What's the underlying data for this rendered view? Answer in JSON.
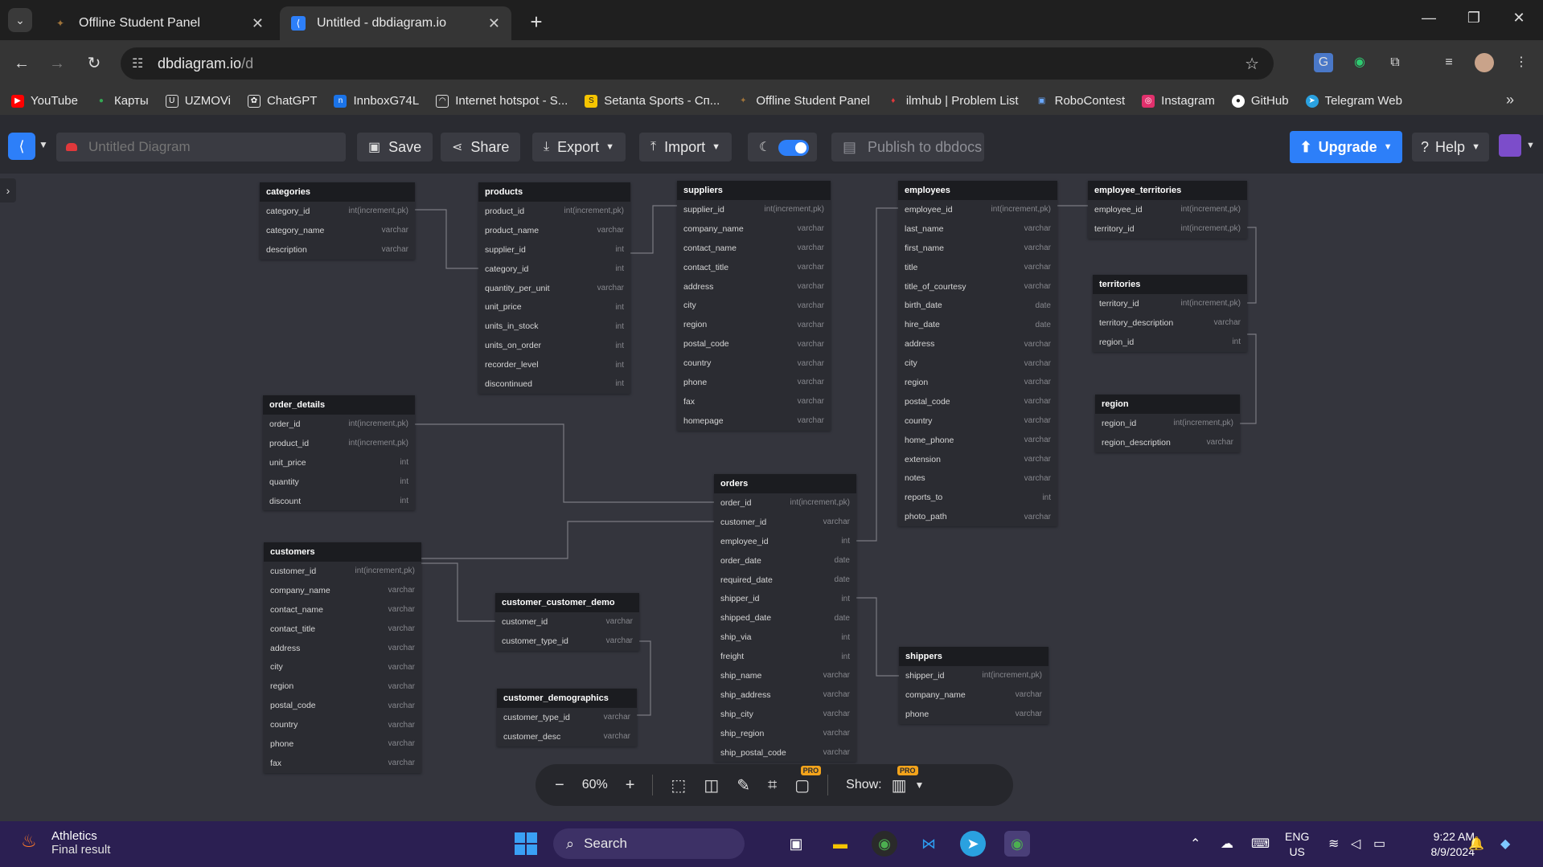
{
  "browser": {
    "tabs": [
      {
        "title": "Offline Student Panel",
        "active": false
      },
      {
        "title": "Untitled - dbdiagram.io",
        "active": true
      }
    ],
    "url_host": "dbdiagram.io",
    "url_path": "/d",
    "bookmarks": [
      {
        "label": "YouTube",
        "icon": "youtube-icon",
        "color": "#ff0000"
      },
      {
        "label": "Карты",
        "icon": "maps-pin-icon",
        "color": "#34a853"
      },
      {
        "label": "UZMOVi",
        "icon": "uzmovi-icon",
        "color": "#ffffff"
      },
      {
        "label": "ChatGPT",
        "icon": "chatgpt-icon",
        "color": "#ffffff"
      },
      {
        "label": "InnboxG74L",
        "icon": "innbox-icon",
        "color": "#1a73e8"
      },
      {
        "label": "Internet hotspot - S...",
        "icon": "hotspot-icon",
        "color": "#ffffff"
      },
      {
        "label": "Setanta Sports - Сп...",
        "icon": "setanta-icon",
        "color": "#f5c400"
      },
      {
        "label": "Offline Student Panel",
        "icon": "student-panel-icon",
        "color": "#a0743a"
      },
      {
        "label": "ilmhub | Problem List",
        "icon": "ilmhub-icon",
        "color": "#e0383b"
      },
      {
        "label": "RoboContest",
        "icon": "robocontest-icon",
        "color": "#6aa9ff"
      },
      {
        "label": "Instagram",
        "icon": "instagram-icon",
        "color": "#e1306c"
      },
      {
        "label": "GitHub",
        "icon": "github-icon",
        "color": "#ffffff"
      },
      {
        "label": "Telegram Web",
        "icon": "telegram-icon",
        "color": "#2aa1e0"
      }
    ]
  },
  "toolbar": {
    "diagram_title_placeholder": "Untitled Diagram",
    "save_label": "Save",
    "share_label": "Share",
    "export_label": "Export",
    "import_label": "Import",
    "publish_label": "Publish to dbdocs",
    "upgrade_label": "Upgrade",
    "help_label": "Help"
  },
  "tables": [
    {
      "name": "categories",
      "columns": [
        {
          "name": "category_id",
          "type": "int(increment,pk)"
        },
        {
          "name": "category_name",
          "type": "varchar"
        },
        {
          "name": "description",
          "type": "varchar"
        }
      ]
    },
    {
      "name": "products",
      "columns": [
        {
          "name": "product_id",
          "type": "int(increment,pk)"
        },
        {
          "name": "product_name",
          "type": "varchar"
        },
        {
          "name": "supplier_id",
          "type": "int"
        },
        {
          "name": "category_id",
          "type": "int"
        },
        {
          "name": "quantity_per_unit",
          "type": "varchar"
        },
        {
          "name": "unit_price",
          "type": "int"
        },
        {
          "name": "units_in_stock",
          "type": "int"
        },
        {
          "name": "units_on_order",
          "type": "int"
        },
        {
          "name": "recorder_level",
          "type": "int"
        },
        {
          "name": "discontinued",
          "type": "int"
        }
      ]
    },
    {
      "name": "suppliers",
      "columns": [
        {
          "name": "supplier_id",
          "type": "int(increment,pk)"
        },
        {
          "name": "company_name",
          "type": "varchar"
        },
        {
          "name": "contact_name",
          "type": "varchar"
        },
        {
          "name": "contact_title",
          "type": "varchar"
        },
        {
          "name": "address",
          "type": "varchar"
        },
        {
          "name": "city",
          "type": "varchar"
        },
        {
          "name": "region",
          "type": "varchar"
        },
        {
          "name": "postal_code",
          "type": "varchar"
        },
        {
          "name": "country",
          "type": "varchar"
        },
        {
          "name": "phone",
          "type": "varchar"
        },
        {
          "name": "fax",
          "type": "varchar"
        },
        {
          "name": "homepage",
          "type": "varchar"
        }
      ]
    },
    {
      "name": "employees",
      "columns": [
        {
          "name": "employee_id",
          "type": "int(increment,pk)"
        },
        {
          "name": "last_name",
          "type": "varchar"
        },
        {
          "name": "first_name",
          "type": "varchar"
        },
        {
          "name": "title",
          "type": "varchar"
        },
        {
          "name": "title_of_courtesy",
          "type": "varchar"
        },
        {
          "name": "birth_date",
          "type": "date"
        },
        {
          "name": "hire_date",
          "type": "date"
        },
        {
          "name": "address",
          "type": "varchar"
        },
        {
          "name": "city",
          "type": "varchar"
        },
        {
          "name": "region",
          "type": "varchar"
        },
        {
          "name": "postal_code",
          "type": "varchar"
        },
        {
          "name": "country",
          "type": "varchar"
        },
        {
          "name": "home_phone",
          "type": "varchar"
        },
        {
          "name": "extension",
          "type": "varchar"
        },
        {
          "name": "notes",
          "type": "varchar"
        },
        {
          "name": "reports_to",
          "type": "int"
        },
        {
          "name": "photo_path",
          "type": "varchar"
        }
      ]
    },
    {
      "name": "employee_territories",
      "columns": [
        {
          "name": "employee_id",
          "type": "int(increment,pk)"
        },
        {
          "name": "territory_id",
          "type": "int(increment,pk)"
        }
      ]
    },
    {
      "name": "territories",
      "columns": [
        {
          "name": "territory_id",
          "type": "int(increment,pk)"
        },
        {
          "name": "territory_description",
          "type": "varchar"
        },
        {
          "name": "region_id",
          "type": "int"
        }
      ]
    },
    {
      "name": "region",
      "columns": [
        {
          "name": "region_id",
          "type": "int(increment,pk)"
        },
        {
          "name": "region_description",
          "type": "varchar"
        }
      ]
    },
    {
      "name": "order_details",
      "columns": [
        {
          "name": "order_id",
          "type": "int(increment,pk)"
        },
        {
          "name": "product_id",
          "type": "int(increment,pk)"
        },
        {
          "name": "unit_price",
          "type": "int"
        },
        {
          "name": "quantity",
          "type": "int"
        },
        {
          "name": "discount",
          "type": "int"
        }
      ]
    },
    {
      "name": "orders",
      "columns": [
        {
          "name": "order_id",
          "type": "int(increment,pk)"
        },
        {
          "name": "customer_id",
          "type": "varchar"
        },
        {
          "name": "employee_id",
          "type": "int"
        },
        {
          "name": "order_date",
          "type": "date"
        },
        {
          "name": "required_date",
          "type": "date"
        },
        {
          "name": "shipper_id",
          "type": "int"
        },
        {
          "name": "shipped_date",
          "type": "date"
        },
        {
          "name": "ship_via",
          "type": "int"
        },
        {
          "name": "freight",
          "type": "int"
        },
        {
          "name": "ship_name",
          "type": "varchar"
        },
        {
          "name": "ship_address",
          "type": "varchar"
        },
        {
          "name": "ship_city",
          "type": "varchar"
        },
        {
          "name": "ship_region",
          "type": "varchar"
        },
        {
          "name": "ship_postal_code",
          "type": "varchar"
        }
      ]
    },
    {
      "name": "customers",
      "columns": [
        {
          "name": "customer_id",
          "type": "int(increment,pk)"
        },
        {
          "name": "company_name",
          "type": "varchar"
        },
        {
          "name": "contact_name",
          "type": "varchar"
        },
        {
          "name": "contact_title",
          "type": "varchar"
        },
        {
          "name": "address",
          "type": "varchar"
        },
        {
          "name": "city",
          "type": "varchar"
        },
        {
          "name": "region",
          "type": "varchar"
        },
        {
          "name": "postal_code",
          "type": "varchar"
        },
        {
          "name": "country",
          "type": "varchar"
        },
        {
          "name": "phone",
          "type": "varchar"
        },
        {
          "name": "fax",
          "type": "varchar"
        }
      ]
    },
    {
      "name": "customer_customer_demo",
      "columns": [
        {
          "name": "customer_id",
          "type": "varchar"
        },
        {
          "name": "customer_type_id",
          "type": "varchar"
        }
      ]
    },
    {
      "name": "customer_demographics",
      "columns": [
        {
          "name": "customer_type_id",
          "type": "varchar"
        },
        {
          "name": "customer_desc",
          "type": "varchar"
        }
      ]
    },
    {
      "name": "shippers",
      "columns": [
        {
          "name": "shipper_id",
          "type": "int(increment,pk)"
        },
        {
          "name": "company_name",
          "type": "varchar"
        },
        {
          "name": "phone",
          "type": "varchar"
        }
      ]
    }
  ],
  "zoombar": {
    "zoom_level": "60%",
    "show_label": "Show:",
    "pro_badge": "PRO"
  },
  "taskbar": {
    "weather_title": "Athletics",
    "weather_subtitle": "Final result",
    "search_placeholder": "Search",
    "lang_1": "ENG",
    "lang_2": "US",
    "time": "9:22 AM",
    "date": "8/9/2024"
  }
}
